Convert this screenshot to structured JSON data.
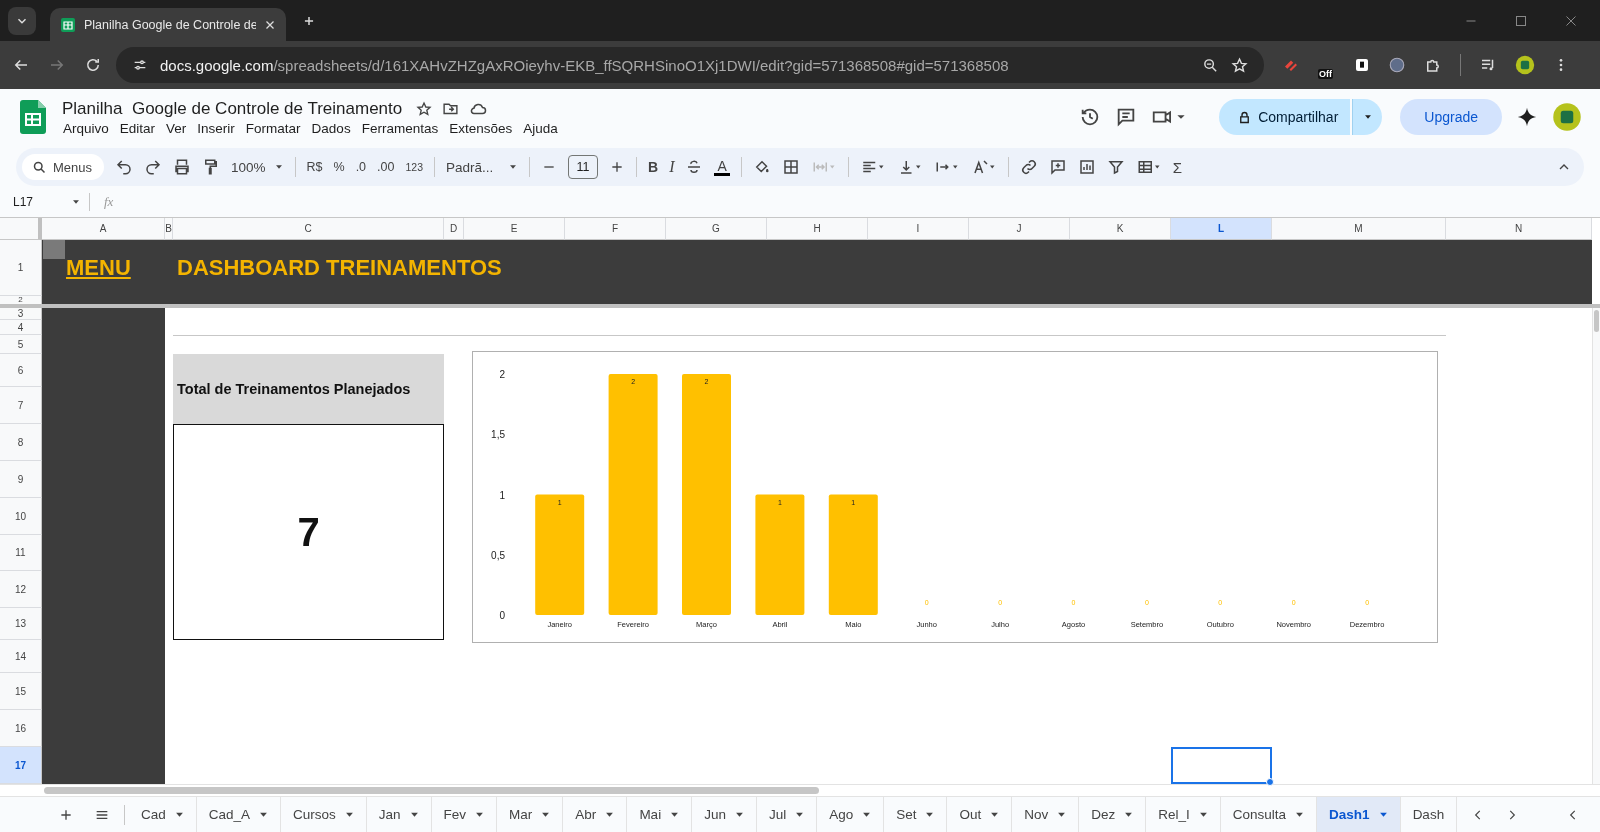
{
  "browser": {
    "tab_title": "Planilha Google de Controle de",
    "url_host": "docs.google.com",
    "url_path": "/spreadsheets/d/161XAHvZHZgAxROieyhv-EKB_ffSQRHSinoO1Xj1DWI/edit?gid=571368508#gid=571368508",
    "extension_badge": "Off"
  },
  "doc": {
    "title": "Planilha  Google de Controle de Treinamento",
    "menus": [
      "Arquivo",
      "Editar",
      "Ver",
      "Inserir",
      "Formatar",
      "Dados",
      "Ferramentas",
      "Extensões",
      "Ajuda"
    ],
    "share_button": "Compartilhar",
    "upgrade_button": "Upgrade"
  },
  "toolbar": {
    "search": "Menus",
    "zoom": "100%",
    "currency": "R$",
    "percent": "%",
    "decrease_decimals": ".0",
    "increase_decimals": ".00",
    "number_format": "123",
    "font": "Padrã...",
    "font_size": "11",
    "bold": "B",
    "italic": "I",
    "text_color": "A",
    "functions": "Σ"
  },
  "formula_bar": {
    "cell_ref": "L17",
    "fx": "fx"
  },
  "columns": [
    {
      "label": "A",
      "selected": false
    },
    {
      "label": "B",
      "selected": false
    },
    {
      "label": "C",
      "selected": false
    },
    {
      "label": "D",
      "selected": false
    },
    {
      "label": "E",
      "selected": false
    },
    {
      "label": "F",
      "selected": false
    },
    {
      "label": "G",
      "selected": false
    },
    {
      "label": "H",
      "selected": false
    },
    {
      "label": "I",
      "selected": false
    },
    {
      "label": "J",
      "selected": false
    },
    {
      "label": "K",
      "selected": false
    },
    {
      "label": "L",
      "selected": true
    },
    {
      "label": "M",
      "selected": false
    },
    {
      "label": "N",
      "selected": false
    }
  ],
  "rows": [
    {
      "label": "1",
      "selected": false
    },
    {
      "label": "2",
      "selected": false
    },
    {
      "label": "3",
      "selected": false
    },
    {
      "label": "4",
      "selected": false
    },
    {
      "label": "5",
      "selected": false
    },
    {
      "label": "6",
      "selected": false
    },
    {
      "label": "7",
      "selected": false
    },
    {
      "label": "8",
      "selected": false
    },
    {
      "label": "9",
      "selected": false
    },
    {
      "label": "10",
      "selected": false
    },
    {
      "label": "11",
      "selected": false
    },
    {
      "label": "12",
      "selected": false
    },
    {
      "label": "13",
      "selected": false
    },
    {
      "label": "14",
      "selected": false
    },
    {
      "label": "15",
      "selected": false
    },
    {
      "label": "16",
      "selected": false
    },
    {
      "label": "17",
      "selected": true
    }
  ],
  "sheet": {
    "menu_link": "MENU",
    "title": "DASHBOARD TREINAMENTOS",
    "card_label": "Total de Treinamentos Planejados",
    "card_value": "7",
    "chart_data": {
      "type": "bar",
      "categories": [
        "Janeiro",
        "Fevereiro",
        "Março",
        "Abril",
        "Maio",
        "Junho",
        "Julho",
        "Agosto",
        "Setembro",
        "Outubro",
        "Novembro",
        "Dezembro"
      ],
      "values": [
        1,
        2,
        2,
        1,
        1,
        0,
        0,
        0,
        0,
        0,
        0,
        0
      ],
      "ylim": [
        0,
        2
      ],
      "yticks": [
        0,
        {
          "value": 0.5,
          "label": "0,5"
        },
        1,
        {
          "value": 1.5,
          "label": "1,5"
        },
        2
      ],
      "data_labels": true
    }
  },
  "sheet_tabs": [
    {
      "label": "Cad",
      "selected": false,
      "menu": true
    },
    {
      "label": "Cad_A",
      "selected": false,
      "menu": true
    },
    {
      "label": "Cursos",
      "selected": false,
      "menu": true
    },
    {
      "label": "Jan",
      "selected": false,
      "menu": true
    },
    {
      "label": "Fev",
      "selected": false,
      "menu": true
    },
    {
      "label": "Mar",
      "selected": false,
      "menu": true
    },
    {
      "label": "Abr",
      "selected": false,
      "menu": true
    },
    {
      "label": "Mai",
      "selected": false,
      "menu": true
    },
    {
      "label": "Jun",
      "selected": false,
      "menu": true
    },
    {
      "label": "Jul",
      "selected": false,
      "menu": true
    },
    {
      "label": "Ago",
      "selected": false,
      "menu": true
    },
    {
      "label": "Set",
      "selected": false,
      "menu": true
    },
    {
      "label": "Out",
      "selected": false,
      "menu": true
    },
    {
      "label": "Nov",
      "selected": false,
      "menu": true
    },
    {
      "label": "Dez",
      "selected": false,
      "menu": true
    },
    {
      "label": "Rel_I",
      "selected": false,
      "menu": true
    },
    {
      "label": "Consulta",
      "selected": false,
      "menu": true
    },
    {
      "label": "Dash1",
      "selected": true,
      "menu": true
    },
    {
      "label": "Dash",
      "selected": false,
      "menu": false
    }
  ]
}
